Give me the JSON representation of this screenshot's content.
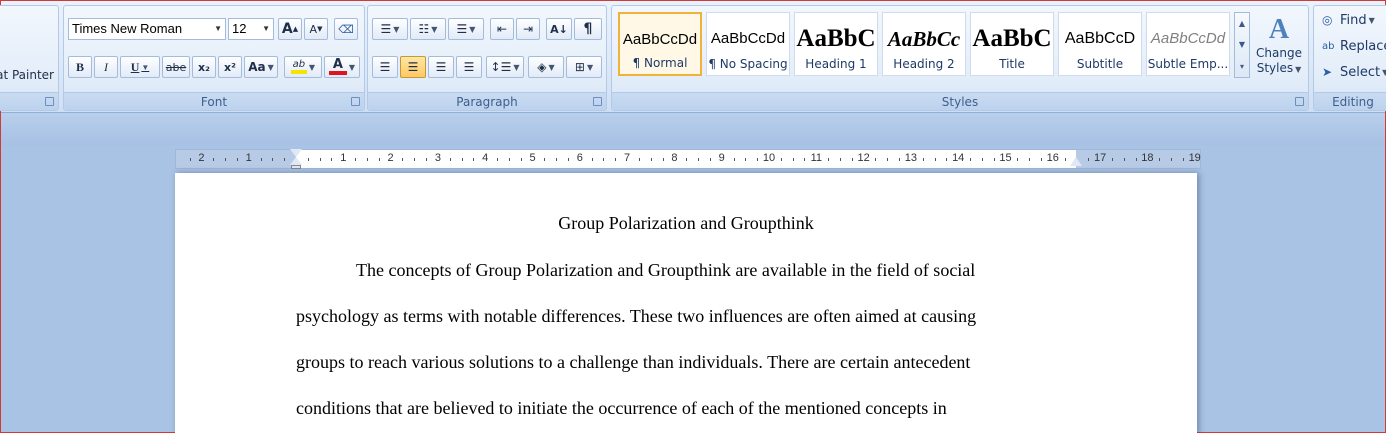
{
  "clipboard": {
    "format_painter_label": "at Painter"
  },
  "font": {
    "group_label": "Font",
    "font_name": "Times New Roman",
    "font_size": "12",
    "grow_label": "A",
    "shrink_label": "A",
    "bold_label": "B",
    "italic_label": "I",
    "underline_label": "U",
    "strike_label": "abe",
    "subscript_label": "x₂",
    "superscript_label": "x²",
    "case_label": "Aa",
    "highlight_label": "ab",
    "font_color_label": "A",
    "highlight_color": "#f5e400",
    "font_color": "#e0141c"
  },
  "paragraph": {
    "group_label": "Paragraph"
  },
  "styles": {
    "group_label": "Styles",
    "items": [
      {
        "preview": "AaBbCcDd",
        "name": "¶ Normal"
      },
      {
        "preview": "AaBbCcDd",
        "name": "¶ No Spacing"
      },
      {
        "preview": "AaBbC",
        "name": "Heading 1"
      },
      {
        "preview": "AaBbCc",
        "name": "Heading 2"
      },
      {
        "preview": "AaBbC",
        "name": "Title"
      },
      {
        "preview": "AaBbCcD",
        "name": "Subtitle"
      },
      {
        "preview": "AaBbCcDd",
        "name": "Subtle Emp..."
      }
    ],
    "change_styles_line1": "Change",
    "change_styles_line2": "Styles"
  },
  "editing": {
    "group_label": "Editing",
    "find_label": "Find",
    "replace_label": "Replace",
    "select_label": "Select"
  },
  "ruler": {
    "left_labels": [
      "2",
      "1"
    ],
    "right_labels": [
      "1",
      "2",
      "3",
      "4",
      "5",
      "6",
      "7",
      "8",
      "9",
      "10",
      "11",
      "12",
      "13",
      "14",
      "15",
      "16",
      "17",
      "18",
      "19"
    ]
  },
  "document": {
    "title": "Group Polarization and Groupthink",
    "lines": [
      "The concepts of Group Polarization and Groupthink are available in the field of social",
      "psychology as terms with notable differences. These two influences are often aimed at causing",
      "groups to reach various solutions to a challenge than individuals. There are certain antecedent",
      "conditions that are believed to initiate the occurrence of each of the mentioned concepts in"
    ]
  }
}
